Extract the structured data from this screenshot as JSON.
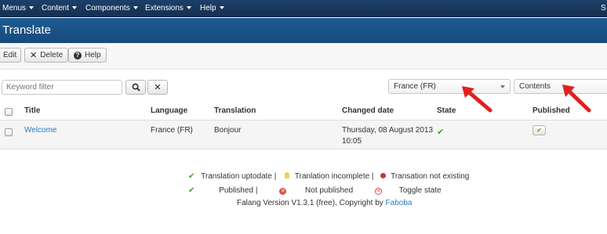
{
  "menu": {
    "items": [
      {
        "label": "Menus"
      },
      {
        "label": "Content"
      },
      {
        "label": "Components"
      },
      {
        "label": "Extensions"
      },
      {
        "label": "Help"
      }
    ],
    "right_text": "S"
  },
  "page": {
    "title": "Translate"
  },
  "toolbar": {
    "edit_label": "Edit",
    "delete_label": "Delete",
    "help_label": "Help"
  },
  "filter": {
    "placeholder": "Keyword filter",
    "search_icon": "search-icon",
    "clear_icon": "clear-icon",
    "language_selected": "France (FR)",
    "content_selected": "Contents"
  },
  "table": {
    "headers": {
      "title": "Title",
      "language": "Language",
      "translation": "Translation",
      "changed_date": "Changed date",
      "state": "State",
      "published": "Published"
    },
    "rows": [
      {
        "title": "Welcome",
        "language": "France (FR)",
        "translation": "Bonjour",
        "changed_date_line1": "Thursday, 08 August 2013",
        "changed_date_line2": "10:05",
        "state_icon": "check-icon",
        "published_icon": "check-icon"
      }
    ]
  },
  "legend": {
    "uptodate": "Translation uptodate |",
    "incomplete": "Tranlation incomplete |",
    "not_existing": "Transation not existing",
    "published": "Published |",
    "not_published": "Not published",
    "toggle_state": "Toggle state",
    "version_text": "Falang Version V1.3.1 (free), Copyright by",
    "version_link": "Faboba"
  },
  "colors": {
    "nav_bg": "#1d3f6b",
    "title_bg": "#1e5a92",
    "link": "#2a7bbf",
    "check_green": "#49a02b",
    "annotation_red": "#e02020"
  }
}
